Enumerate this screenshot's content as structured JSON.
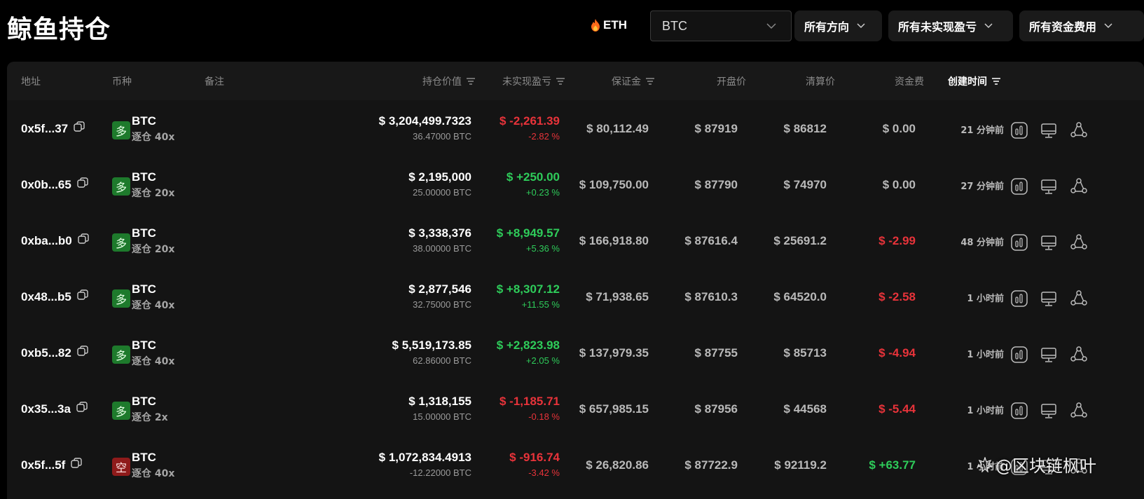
{
  "header": {
    "title": "鲸鱼持仓",
    "eth_label": "ETH",
    "coin_select_value": "BTC",
    "filters": [
      {
        "label": "所有方向"
      },
      {
        "label": "所有未实现盈亏"
      },
      {
        "label": "所有资金费用"
      }
    ]
  },
  "table": {
    "columns": {
      "address": "地址",
      "coin": "币种",
      "note": "备注",
      "position_value": "持仓价值",
      "unrealized_pnl": "未实现盈亏",
      "margin": "保证金",
      "entry_price": "开盘价",
      "liq_price": "清算价",
      "funding": "资金费",
      "created": "创建时间"
    },
    "rows": [
      {
        "address": "0x5f...37",
        "side": "多",
        "side_type": "long",
        "coin": "BTC",
        "mode": "逐仓 40x",
        "value": "$ 3,204,499.7323",
        "size": "36.47000 BTC",
        "pnl": "$ -2,261.39",
        "pnl_pct": "-2.82 %",
        "pnl_sign": "neg",
        "margin": "$ 80,112.49",
        "entry": "$ 87919",
        "liq": "$ 86812",
        "funding": "$ 0.00",
        "funding_sign": "zero",
        "created": "21 分钟前"
      },
      {
        "address": "0x0b...65",
        "side": "多",
        "side_type": "long",
        "coin": "BTC",
        "mode": "逐仓 20x",
        "value": "$ 2,195,000",
        "size": "25.00000 BTC",
        "pnl": "$ +250.00",
        "pnl_pct": "+0.23 %",
        "pnl_sign": "pos",
        "margin": "$ 109,750.00",
        "entry": "$ 87790",
        "liq": "$ 74970",
        "funding": "$ 0.00",
        "funding_sign": "zero",
        "created": "27 分钟前"
      },
      {
        "address": "0xba...b0",
        "side": "多",
        "side_type": "long",
        "coin": "BTC",
        "mode": "逐仓 20x",
        "value": "$ 3,338,376",
        "size": "38.00000 BTC",
        "pnl": "$ +8,949.57",
        "pnl_pct": "+5.36 %",
        "pnl_sign": "pos",
        "margin": "$ 166,918.80",
        "entry": "$ 87616.4",
        "liq": "$ 25691.2",
        "funding": "$ -2.99",
        "funding_sign": "neg",
        "created": "48 分钟前"
      },
      {
        "address": "0x48...b5",
        "side": "多",
        "side_type": "long",
        "coin": "BTC",
        "mode": "逐仓 40x",
        "value": "$ 2,877,546",
        "size": "32.75000 BTC",
        "pnl": "$ +8,307.12",
        "pnl_pct": "+11.55 %",
        "pnl_sign": "pos",
        "margin": "$ 71,938.65",
        "entry": "$ 87610.3",
        "liq": "$ 64520.0",
        "funding": "$ -2.58",
        "funding_sign": "neg",
        "created": "1 小时前"
      },
      {
        "address": "0xb5...82",
        "side": "多",
        "side_type": "long",
        "coin": "BTC",
        "mode": "逐仓 40x",
        "value": "$ 5,519,173.85",
        "size": "62.86000 BTC",
        "pnl": "$ +2,823.98",
        "pnl_pct": "+2.05 %",
        "pnl_sign": "pos",
        "margin": "$ 137,979.35",
        "entry": "$ 87755",
        "liq": "$ 85713",
        "funding": "$ -4.94",
        "funding_sign": "neg",
        "created": "1 小时前"
      },
      {
        "address": "0x35...3a",
        "side": "多",
        "side_type": "long",
        "coin": "BTC",
        "mode": "逐仓 2x",
        "value": "$ 1,318,155",
        "size": "15.00000 BTC",
        "pnl": "$ -1,185.71",
        "pnl_pct": "-0.18 %",
        "pnl_sign": "neg",
        "margin": "$ 657,985.15",
        "entry": "$ 87956",
        "liq": "$ 44568",
        "funding": "$ -5.44",
        "funding_sign": "neg",
        "created": "1 小时前"
      },
      {
        "address": "0x5f...5f",
        "side": "空",
        "side_type": "short",
        "coin": "BTC",
        "mode": "逐仓 40x",
        "value": "$ 1,072,834.4913",
        "size": "-12.22000 BTC",
        "pnl": "$ -916.74",
        "pnl_pct": "-3.42 %",
        "pnl_sign": "neg",
        "margin": "$ 26,820.86",
        "entry": "$ 87722.9",
        "liq": "$ 92119.2",
        "funding": "$ +63.77",
        "funding_sign": "pos",
        "created": "1 小时前"
      }
    ]
  },
  "watermark": "@区块链枫叶",
  "colors": {
    "positive": "#2ecc5a",
    "negative": "#e8333a",
    "long_badge": "#1e7a2c",
    "short_badge": "#8f1b1b"
  }
}
